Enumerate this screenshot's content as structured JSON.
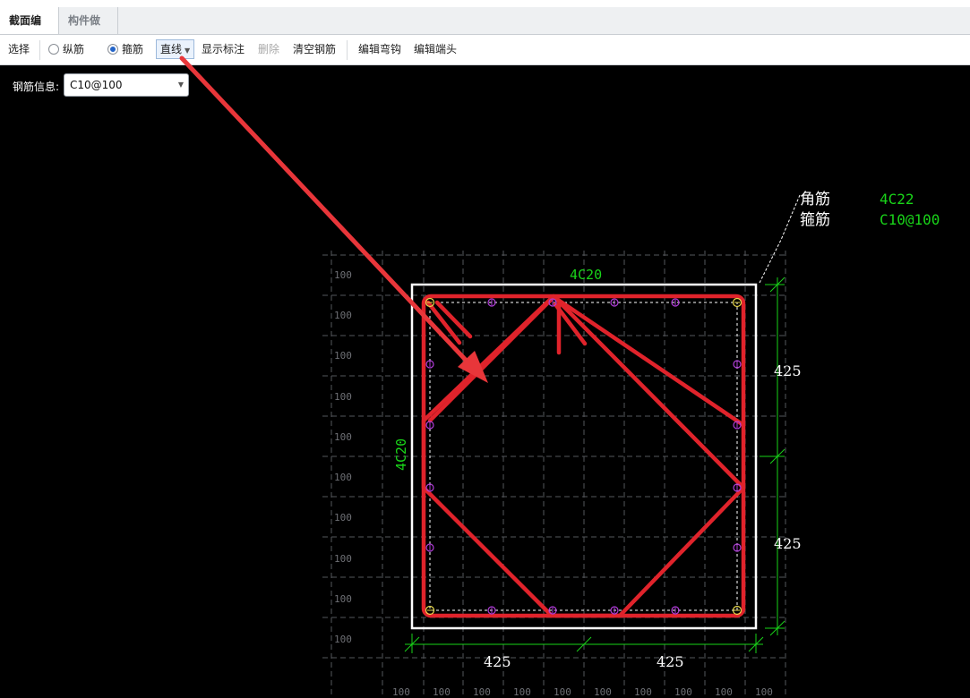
{
  "tabs": [
    {
      "label": "截面编辑",
      "active": true
    },
    {
      "label": "构件做法",
      "active": false
    }
  ],
  "toolbar": {
    "select": "选择",
    "longitudinal": "纵筋",
    "stirrup": "箍筋",
    "stirrup_selected": true,
    "line_dropdown": "直线",
    "show_annotation": "显示标注",
    "delete": "删除",
    "clear_rebar": "清空钢筋",
    "edit_hook": "编辑弯钩",
    "edit_end": "编辑端头"
  },
  "rebar_info": {
    "label": "钢筋信息:",
    "value": "C10@100"
  },
  "legend": {
    "corner_label": "角筋",
    "corner_value": "4C22",
    "stirrup_label": "箍筋",
    "stirrup_value": "C10@100"
  },
  "annotations": {
    "top_rebar": "4C20",
    "left_rebar": "4C20",
    "right_dim_upper": "425",
    "right_dim_lower": "425",
    "bottom_dim_left": "425",
    "bottom_dim_right": "425"
  },
  "grid_label": "100",
  "colors": {
    "rebar": "#e0232b",
    "dimension": "#19d419",
    "outline": "#ffffff",
    "bar_marker": "#b03cd8",
    "corner_marker": "#e8d84a",
    "arrow": "#e8363a"
  }
}
